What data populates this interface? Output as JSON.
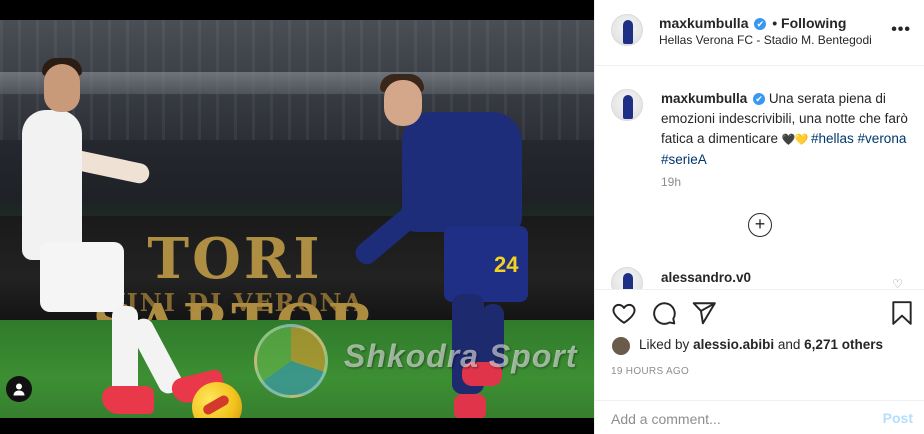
{
  "post": {
    "username": "maxkumbulla",
    "verified_glyph": "✔",
    "following_label": "• Following",
    "location": "Hellas Verona FC - Stadio M. Bentegodi",
    "more_glyph": "•••"
  },
  "photo": {
    "ad_text": "TORI SARTOR",
    "ad_subtext": "VINI DI VERONA",
    "shorts_number": "24",
    "watermark_text": "Shkodra Sport"
  },
  "caption": {
    "username": "maxkumbulla",
    "text": "Una serata piena di emozioni indescrivibili, una notte che farò fatica a dimenticare",
    "hearts": "🖤💛",
    "hashtags": [
      "#hellas",
      "#verona",
      "#serieA"
    ],
    "time": "19h"
  },
  "comments": {
    "load_more_glyph": "+",
    "items": [
      {
        "username": "alessandro.v0"
      }
    ]
  },
  "likes": {
    "prefix": "Liked by",
    "user": "alessio.abibi",
    "and": "and",
    "count": "6,271 others"
  },
  "timestamp": "19 HOURS AGO",
  "add_comment": {
    "placeholder": "Add a comment...",
    "post_label": "Post"
  },
  "icons": {
    "like": "heart-icon",
    "comment": "comment-icon",
    "share": "share-icon",
    "save": "bookmark-icon",
    "tag": "person-tag-icon"
  },
  "colors": {
    "hashtag": "#00376b",
    "verified": "#3897f0",
    "post_disabled": "#b2dffc",
    "muted": "#8e8e8e"
  }
}
